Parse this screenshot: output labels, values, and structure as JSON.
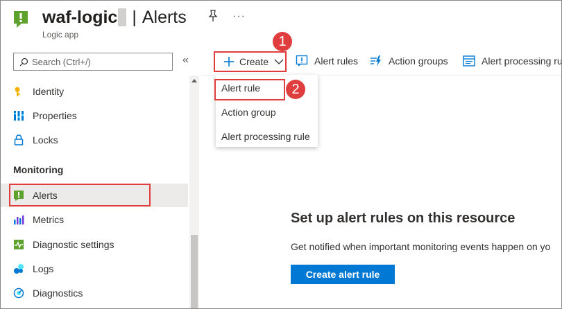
{
  "header": {
    "resource_name": "waf-logic",
    "title_separator": "|",
    "page_title": "Alerts",
    "resource_type": "Logic app",
    "pin_icon": "pin-icon",
    "more_label": "···"
  },
  "search": {
    "placeholder": "Search (Ctrl+/)",
    "value": ""
  },
  "sidebar": {
    "collapse_label": "«",
    "section_header": "Monitoring",
    "items": [
      {
        "label": "Identity",
        "icon": "identity-key-icon"
      },
      {
        "label": "Properties",
        "icon": "properties-icon"
      },
      {
        "label": "Locks",
        "icon": "lock-icon"
      },
      {
        "label": "Alerts",
        "icon": "alert-icon",
        "active": true
      },
      {
        "label": "Metrics",
        "icon": "metrics-icon"
      },
      {
        "label": "Diagnostic settings",
        "icon": "diagnostic-settings-icon"
      },
      {
        "label": "Logs",
        "icon": "logs-icon"
      },
      {
        "label": "Diagnostics",
        "icon": "diagnostics-icon"
      }
    ]
  },
  "toolbar": {
    "create_label": "Create",
    "alert_rules_label": "Alert rules",
    "action_groups_label": "Action groups",
    "alert_processing_label": "Alert processing ru"
  },
  "create_menu": {
    "items": [
      "Alert rule",
      "Action group",
      "Alert processing rule"
    ]
  },
  "callouts": [
    "1",
    "2"
  ],
  "empty_state": {
    "title": "Set up alert rules on this resource",
    "description": "Get notified when important monitoring events happen on yo",
    "button_label": "Create alert rule"
  },
  "colors": {
    "accent": "#0078d4",
    "highlight": "#e03e3e",
    "logic_app_green": "#5ea12d"
  }
}
